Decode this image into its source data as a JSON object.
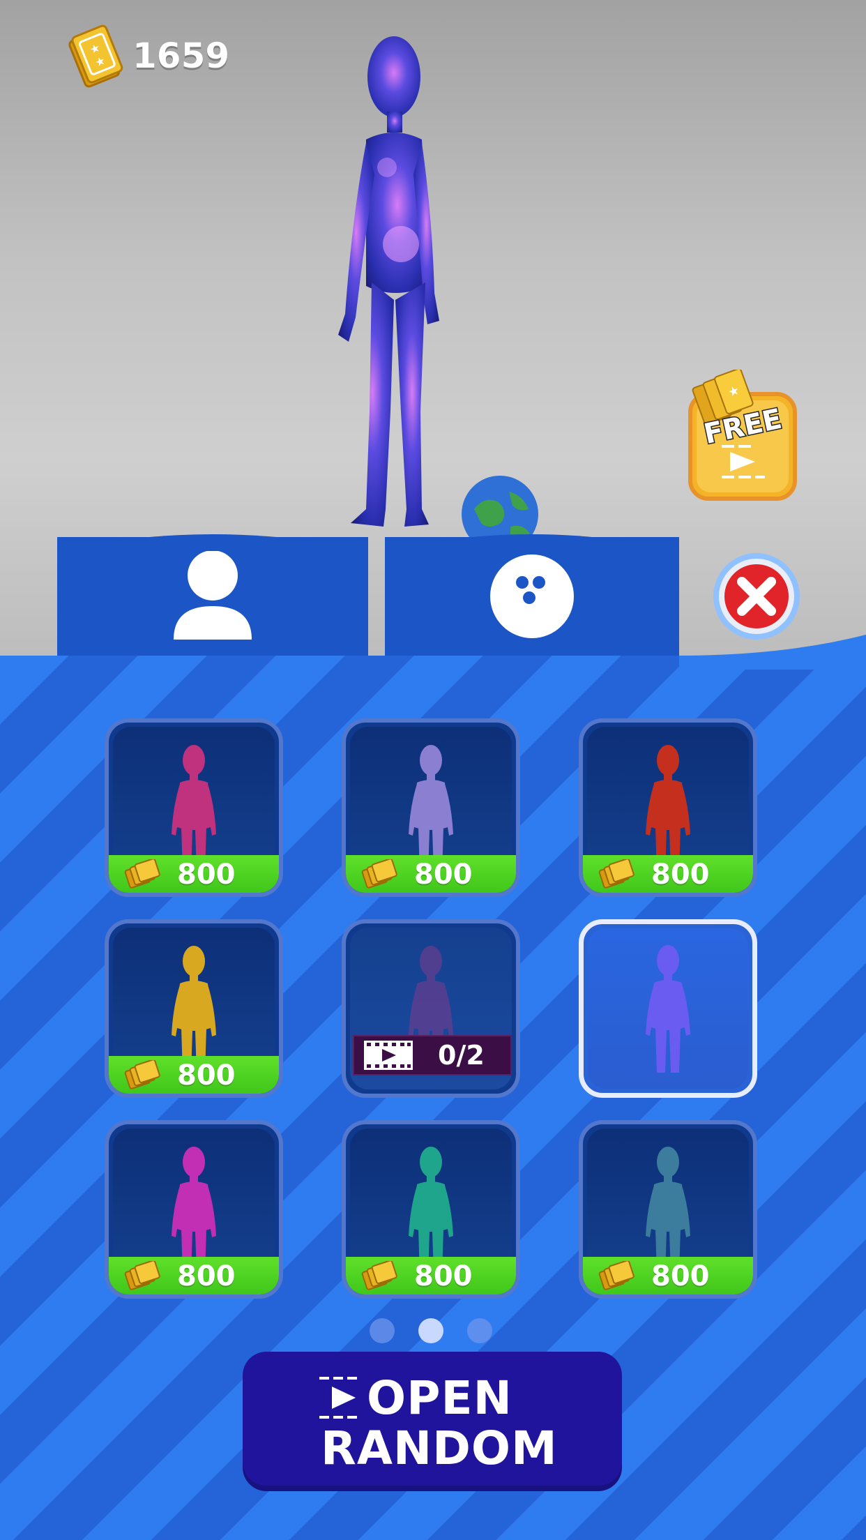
{
  "hud": {
    "coins": "1659",
    "coin_icon": "ticket-stack-icon"
  },
  "free_offer": {
    "label": "FREE",
    "icon": "video-play-icon"
  },
  "tabs": [
    {
      "id": "characters",
      "icon": "person-icon",
      "selected": true
    },
    {
      "id": "balls",
      "icon": "bowling-ball-icon",
      "selected": false
    }
  ],
  "close": {
    "icon": "close-x-icon"
  },
  "colors": {
    "price_green": "#4ad620",
    "panel_blue": "#2f7cf0",
    "button_navy": "#20149c",
    "tab_blue": "#1b55c6"
  },
  "skins": [
    {
      "name": "black-hair-girl",
      "price": "800",
      "color": "#c0317e"
    },
    {
      "name": "purple",
      "price": "800",
      "color": "#8a7fd0"
    },
    {
      "name": "red",
      "price": "800",
      "color": "#c4301d"
    },
    {
      "name": "yellow",
      "price": "800",
      "color": "#d7a820"
    },
    {
      "name": "pink-locked",
      "ad_progress": "0/2",
      "color": "#8a3a8c"
    },
    {
      "name": "galaxy",
      "selected": true,
      "color": "#6a5cf0"
    },
    {
      "name": "magenta",
      "price": "800",
      "color": "#c32fb4"
    },
    {
      "name": "frog",
      "price": "800",
      "color": "#1fa58c"
    },
    {
      "name": "blue-suit",
      "price": "800",
      "color": "#3c7c9c"
    }
  ],
  "pagination": {
    "pages": 3,
    "current": 2
  },
  "open_random": {
    "line1": "OPEN",
    "line2": "RANDOM",
    "icon": "video-play-icon"
  }
}
